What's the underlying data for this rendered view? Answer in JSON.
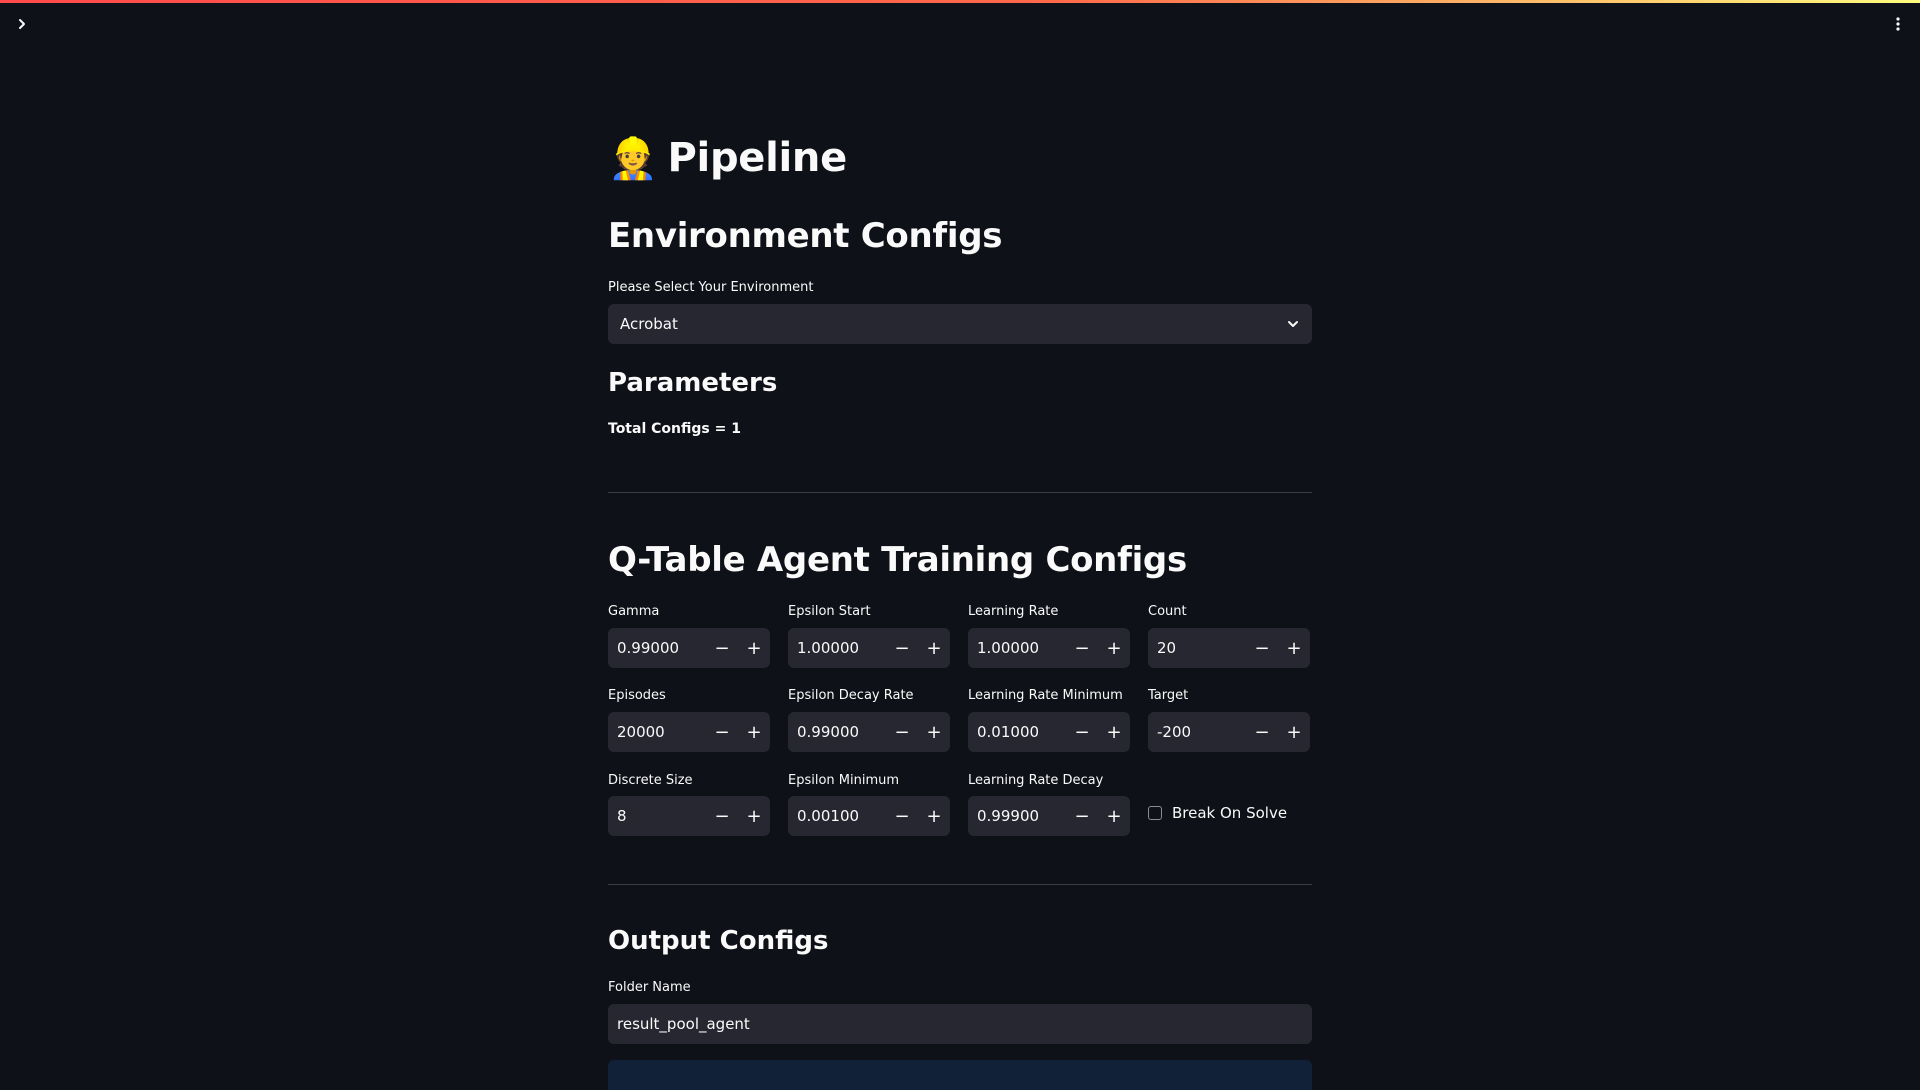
{
  "title": {
    "emoji": "👷",
    "text": "Pipeline"
  },
  "environment": {
    "heading": "Environment Configs",
    "select_label": "Please Select Your Environment",
    "selected": "Acrobat"
  },
  "parameters": {
    "heading": "Parameters",
    "total_configs": "Total Configs = 1"
  },
  "training": {
    "heading": "Q-Table Agent Training Configs",
    "fields": [
      {
        "label": "Gamma",
        "value": "0.99000"
      },
      {
        "label": "Epsilon Start",
        "value": "1.00000"
      },
      {
        "label": "Learning Rate",
        "value": "1.00000"
      },
      {
        "label": "Count",
        "value": "20"
      },
      {
        "label": "Episodes",
        "value": "20000"
      },
      {
        "label": "Epsilon Decay Rate",
        "value": "0.99000"
      },
      {
        "label": "Learning Rate Minimum",
        "value": "0.01000"
      },
      {
        "label": "Target",
        "value": "-200"
      },
      {
        "label": "Discrete Size",
        "value": "8"
      },
      {
        "label": "Epsilon Minimum",
        "value": "0.00100"
      },
      {
        "label": "Learning Rate Decay",
        "value": "0.99900"
      }
    ],
    "checkbox": {
      "label": "Break On Solve",
      "checked": false
    },
    "step_minus": "−",
    "step_plus": "+"
  },
  "output": {
    "heading": "Output Configs",
    "folder_label": "Folder Name",
    "folder_value": "result_pool_agent"
  },
  "icons": {
    "sidebar_toggle": "chevron-right-icon",
    "menu": "vertical-dots-icon",
    "select_chevron": "chevron-down-icon"
  },
  "colors": {
    "background": "#0e1117",
    "input_bg": "#262730",
    "accent_red": "#ff4b4b",
    "accent_yellow": "#fffd80"
  }
}
